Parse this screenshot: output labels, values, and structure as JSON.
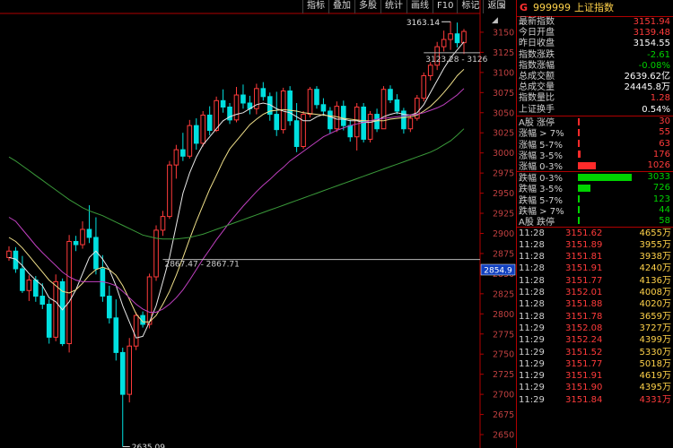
{
  "toolbar": {
    "buttons": [
      "指标",
      "叠加",
      "多股",
      "统计",
      "画线",
      "F10",
      "标记",
      "返回"
    ],
    "collapse_glyph": "◢",
    "close_glyph": "✕"
  },
  "chart_data": {
    "type": "candlestick",
    "title": "",
    "ylim": [
      2640,
      3170
    ],
    "y_ticks": [
      2650,
      2675,
      2700,
      2725,
      2750,
      2775,
      2800,
      2825,
      2850,
      2875,
      2900,
      2925,
      2950,
      2975,
      3000,
      3025,
      3050,
      3075,
      3100,
      3125,
      3150
    ],
    "annotations": {
      "high_label": "3163.14",
      "low_label": "2635.09",
      "range_label_low": "2867.47 - 2867.71",
      "range_label_high": "3123.28 - 3126",
      "price_marker": "2854.9"
    },
    "candles": [
      {
        "o": 2870,
        "h": 2884,
        "l": 2866,
        "c": 2878
      },
      {
        "o": 2878,
        "h": 2883,
        "l": 2851,
        "c": 2856
      },
      {
        "o": 2856,
        "h": 2872,
        "l": 2826,
        "c": 2829
      },
      {
        "o": 2829,
        "h": 2848,
        "l": 2816,
        "c": 2842
      },
      {
        "o": 2842,
        "h": 2847,
        "l": 2815,
        "c": 2822
      },
      {
        "o": 2822,
        "h": 2838,
        "l": 2806,
        "c": 2812
      },
      {
        "o": 2812,
        "h": 2818,
        "l": 2763,
        "c": 2771
      },
      {
        "o": 2771,
        "h": 2849,
        "l": 2766,
        "c": 2840
      },
      {
        "o": 2840,
        "h": 2844,
        "l": 2760,
        "c": 2763
      },
      {
        "o": 2763,
        "h": 2898,
        "l": 2752,
        "c": 2890
      },
      {
        "o": 2890,
        "h": 2897,
        "l": 2878,
        "c": 2886
      },
      {
        "o": 2886,
        "h": 2915,
        "l": 2881,
        "c": 2905
      },
      {
        "o": 2905,
        "h": 2935,
        "l": 2888,
        "c": 2895
      },
      {
        "o": 2895,
        "h": 2920,
        "l": 2849,
        "c": 2856
      },
      {
        "o": 2856,
        "h": 2873,
        "l": 2815,
        "c": 2822
      },
      {
        "o": 2822,
        "h": 2835,
        "l": 2788,
        "c": 2795
      },
      {
        "o": 2795,
        "h": 2818,
        "l": 2742,
        "c": 2752
      },
      {
        "o": 2752,
        "h": 2758,
        "l": 2635,
        "c": 2700
      },
      {
        "o": 2700,
        "h": 2770,
        "l": 2690,
        "c": 2760
      },
      {
        "o": 2760,
        "h": 2802,
        "l": 2755,
        "c": 2798
      },
      {
        "o": 2798,
        "h": 2803,
        "l": 2783,
        "c": 2787
      },
      {
        "o": 2787,
        "h": 2850,
        "l": 2782,
        "c": 2846
      },
      {
        "o": 2846,
        "h": 2910,
        "l": 2841,
        "c": 2904
      },
      {
        "o": 2904,
        "h": 2928,
        "l": 2897,
        "c": 2921
      },
      {
        "o": 2921,
        "h": 2990,
        "l": 2918,
        "c": 2985
      },
      {
        "o": 2985,
        "h": 3010,
        "l": 2968,
        "c": 3004
      },
      {
        "o": 3004,
        "h": 3025,
        "l": 2990,
        "c": 2996
      },
      {
        "o": 2996,
        "h": 3041,
        "l": 2993,
        "c": 3034
      },
      {
        "o": 3034,
        "h": 3043,
        "l": 3004,
        "c": 3012
      },
      {
        "o": 3012,
        "h": 3052,
        "l": 3008,
        "c": 3047
      },
      {
        "o": 3047,
        "h": 3058,
        "l": 3022,
        "c": 3028
      },
      {
        "o": 3028,
        "h": 3070,
        "l": 3026,
        "c": 3065
      },
      {
        "o": 3065,
        "h": 3079,
        "l": 3050,
        "c": 3057
      },
      {
        "o": 3057,
        "h": 3062,
        "l": 3036,
        "c": 3041
      },
      {
        "o": 3041,
        "h": 3082,
        "l": 3038,
        "c": 3072
      },
      {
        "o": 3072,
        "h": 3085,
        "l": 3055,
        "c": 3062
      },
      {
        "o": 3062,
        "h": 3071,
        "l": 3048,
        "c": 3055
      },
      {
        "o": 3055,
        "h": 3086,
        "l": 3048,
        "c": 3080
      },
      {
        "o": 3080,
        "h": 3088,
        "l": 3065,
        "c": 3070
      },
      {
        "o": 3070,
        "h": 3075,
        "l": 3040,
        "c": 3048
      },
      {
        "o": 3048,
        "h": 3076,
        "l": 3021,
        "c": 3029
      },
      {
        "o": 3029,
        "h": 3081,
        "l": 3024,
        "c": 3077
      },
      {
        "o": 3077,
        "h": 3083,
        "l": 3034,
        "c": 3040
      },
      {
        "o": 3040,
        "h": 3062,
        "l": 3001,
        "c": 3008
      },
      {
        "o": 3008,
        "h": 3052,
        "l": 3005,
        "c": 3048
      },
      {
        "o": 3048,
        "h": 3082,
        "l": 3044,
        "c": 3079
      },
      {
        "o": 3079,
        "h": 3083,
        "l": 3055,
        "c": 3060
      },
      {
        "o": 3060,
        "h": 3068,
        "l": 3046,
        "c": 3052
      },
      {
        "o": 3052,
        "h": 3057,
        "l": 3024,
        "c": 3030
      },
      {
        "o": 3030,
        "h": 3064,
        "l": 3026,
        "c": 3058
      },
      {
        "o": 3058,
        "h": 3065,
        "l": 3028,
        "c": 3034
      },
      {
        "o": 3034,
        "h": 3041,
        "l": 3014,
        "c": 3020
      },
      {
        "o": 3020,
        "h": 3062,
        "l": 3003,
        "c": 3057
      },
      {
        "o": 3057,
        "h": 3062,
        "l": 3013,
        "c": 3017
      },
      {
        "o": 3017,
        "h": 3052,
        "l": 3013,
        "c": 3048
      },
      {
        "o": 3048,
        "h": 3055,
        "l": 3026,
        "c": 3030
      },
      {
        "o": 3030,
        "h": 3083,
        "l": 3030,
        "c": 3079
      },
      {
        "o": 3079,
        "h": 3084,
        "l": 3062,
        "c": 3066
      },
      {
        "o": 3066,
        "h": 3073,
        "l": 3048,
        "c": 3052
      },
      {
        "o": 3052,
        "h": 3056,
        "l": 3024,
        "c": 3030
      },
      {
        "o": 3030,
        "h": 3048,
        "l": 3026,
        "c": 3043
      },
      {
        "o": 3043,
        "h": 3072,
        "l": 3040,
        "c": 3068
      },
      {
        "o": 3068,
        "h": 3100,
        "l": 3064,
        "c": 3096
      },
      {
        "o": 3096,
        "h": 3113,
        "l": 3090,
        "c": 3109
      },
      {
        "o": 3109,
        "h": 3138,
        "l": 3103,
        "c": 3132
      },
      {
        "o": 3132,
        "h": 3152,
        "l": 3126,
        "c": 3141
      },
      {
        "o": 3141,
        "h": 3163,
        "l": 3128,
        "c": 3148
      },
      {
        "o": 3148,
        "h": 3162,
        "l": 3131,
        "c": 3137
      },
      {
        "o": 3137,
        "h": 3154,
        "l": 3123,
        "c": 3151
      }
    ],
    "ma_series": [
      {
        "color": "#e8e8e8",
        "values": [
          2870,
          2868,
          2860,
          2850,
          2842,
          2835,
          2820,
          2815,
          2805,
          2815,
          2830,
          2850,
          2870,
          2878,
          2868,
          2855,
          2835,
          2810,
          2790,
          2770,
          2772,
          2790,
          2810,
          2840,
          2870,
          2910,
          2950,
          2975,
          2995,
          3010,
          3020,
          3030,
          3040,
          3045,
          3048,
          3050,
          3055,
          3060,
          3062,
          3060,
          3055,
          3052,
          3050,
          3045,
          3040,
          3040,
          3045,
          3048,
          3045,
          3042,
          3042,
          3040,
          3040,
          3038,
          3038,
          3040,
          3045,
          3048,
          3050,
          3048,
          3047,
          3050,
          3060,
          3075,
          3090,
          3105,
          3118,
          3128,
          3138
        ]
      },
      {
        "color": "#f0e08a",
        "values": [
          2895,
          2890,
          2882,
          2872,
          2862,
          2852,
          2842,
          2835,
          2828,
          2826,
          2830,
          2838,
          2848,
          2855,
          2858,
          2855,
          2848,
          2835,
          2818,
          2800,
          2790,
          2790,
          2798,
          2812,
          2828,
          2848,
          2870,
          2893,
          2915,
          2935,
          2955,
          2972,
          2990,
          3005,
          3015,
          3025,
          3035,
          3042,
          3048,
          3052,
          3053,
          3054,
          3053,
          3052,
          3050,
          3049,
          3048,
          3047,
          3046,
          3045,
          3043,
          3042,
          3041,
          3040,
          3040,
          3040,
          3040,
          3042,
          3043,
          3044,
          3045,
          3047,
          3052,
          3058,
          3066,
          3075,
          3085,
          3096,
          3104
        ]
      },
      {
        "color": "#c040c0",
        "values": [
          2920,
          2915,
          2905,
          2895,
          2885,
          2876,
          2868,
          2860,
          2852,
          2846,
          2842,
          2840,
          2840,
          2840,
          2840,
          2838,
          2835,
          2828,
          2820,
          2812,
          2806,
          2802,
          2802,
          2806,
          2812,
          2820,
          2830,
          2842,
          2855,
          2868,
          2880,
          2892,
          2903,
          2914,
          2924,
          2934,
          2943,
          2952,
          2960,
          2967,
          2975,
          2982,
          2990,
          2996,
          3002,
          3008,
          3014,
          3020,
          3024,
          3028,
          3031,
          3034,
          3036,
          3038,
          3040,
          3042,
          3043,
          3044,
          3045,
          3046,
          3047,
          3048,
          3050,
          3053,
          3056,
          3060,
          3066,
          3072,
          3080
        ]
      },
      {
        "color": "#3a9a3a",
        "values": [
          2995,
          2990,
          2984,
          2978,
          2972,
          2966,
          2960,
          2954,
          2948,
          2942,
          2937,
          2932,
          2928,
          2925,
          2922,
          2918,
          2914,
          2910,
          2906,
          2902,
          2898,
          2896,
          2894,
          2893,
          2893,
          2893,
          2894,
          2895,
          2897,
          2899,
          2902,
          2905,
          2908,
          2911,
          2914,
          2917,
          2920,
          2923,
          2926,
          2929,
          2932,
          2935,
          2938,
          2941,
          2944,
          2947,
          2950,
          2953,
          2956,
          2959,
          2962,
          2965,
          2968,
          2971,
          2974,
          2977,
          2980,
          2983,
          2986,
          2989,
          2992,
          2995,
          2998,
          3001,
          3005,
          3010,
          3015,
          3022,
          3030
        ]
      }
    ]
  },
  "quote": {
    "g_marker": "G",
    "code": "999999",
    "name": "上证指数",
    "rows": [
      {
        "label": "最新指数",
        "value": "3151.94",
        "cls": "red"
      },
      {
        "label": "今日开盘",
        "value": "3139.48",
        "cls": "red"
      },
      {
        "label": "昨日收盘",
        "value": "3154.55",
        "cls": "white"
      },
      {
        "label": "指数涨跌",
        "value": "-2.61",
        "cls": "green"
      },
      {
        "label": "指数涨幅",
        "value": "-0.08%",
        "cls": "green"
      },
      {
        "label": "总成交额",
        "value": "2639.62亿",
        "cls": "white"
      },
      {
        "label": "总成交量",
        "value": "24445.8万",
        "cls": "white"
      },
      {
        "label": "指数量比",
        "value": "1.28",
        "cls": "red"
      },
      {
        "label": "上证换手",
        "value": "0.54%",
        "cls": "white"
      }
    ],
    "distribution": [
      {
        "label": "A股 涨停",
        "value": "30",
        "cls": "red",
        "frac": 0.01,
        "color": "#ff2a2a"
      },
      {
        "label": "涨幅 > 7%",
        "value": "55",
        "cls": "red",
        "frac": 0.018,
        "color": "#ff2a2a"
      },
      {
        "label": "涨幅 5-7%",
        "value": "63",
        "cls": "red",
        "frac": 0.021,
        "color": "#ff2a2a"
      },
      {
        "label": "涨幅 3-5%",
        "value": "176",
        "cls": "red",
        "frac": 0.058,
        "color": "#ff2a2a"
      },
      {
        "label": "涨幅 0-3%",
        "value": "1026",
        "cls": "red",
        "frac": 0.34,
        "color": "#ff2a2a"
      },
      {
        "label": "跌幅 0-3%",
        "value": "3033",
        "cls": "green",
        "frac": 1.0,
        "color": "#00d200"
      },
      {
        "label": "跌幅 3-5%",
        "value": "726",
        "cls": "green",
        "frac": 0.24,
        "color": "#00d200"
      },
      {
        "label": "跌幅 5-7%",
        "value": "123",
        "cls": "green",
        "frac": 0.041,
        "color": "#00d200"
      },
      {
        "label": "跌幅 > 7%",
        "value": "44",
        "cls": "green",
        "frac": 0.015,
        "color": "#00d200"
      },
      {
        "label": "A股 跌停",
        "value": "58",
        "cls": "green",
        "frac": 0.019,
        "color": "#00d200"
      }
    ],
    "ticks": [
      {
        "time": "11:28",
        "price": "3151.62",
        "vol": "4655万",
        "vcls": ""
      },
      {
        "time": "11:28",
        "price": "3151.89",
        "vol": "3955万",
        "vcls": ""
      },
      {
        "time": "11:28",
        "price": "3151.81",
        "vol": "3938万",
        "vcls": ""
      },
      {
        "time": "11:28",
        "price": "3151.91",
        "vol": "4240万",
        "vcls": ""
      },
      {
        "time": "11:28",
        "price": "3151.77",
        "vol": "4136万",
        "vcls": ""
      },
      {
        "time": "11:28",
        "price": "3152.01",
        "vol": "4008万",
        "vcls": ""
      },
      {
        "time": "11:28",
        "price": "3151.88",
        "vol": "4020万",
        "vcls": ""
      },
      {
        "time": "11:28",
        "price": "3151.78",
        "vol": "3659万",
        "vcls": ""
      },
      {
        "time": "11:29",
        "price": "3152.08",
        "vol": "3727万",
        "vcls": ""
      },
      {
        "time": "11:29",
        "price": "3152.24",
        "vol": "4399万",
        "vcls": ""
      },
      {
        "time": "11:29",
        "price": "3151.52",
        "vol": "5330万",
        "vcls": ""
      },
      {
        "time": "11:29",
        "price": "3151.77",
        "vol": "5018万",
        "vcls": ""
      },
      {
        "time": "11:29",
        "price": "3151.91",
        "vol": "4619万",
        "vcls": ""
      },
      {
        "time": "11:29",
        "price": "3151.90",
        "vol": "4395万",
        "vcls": ""
      },
      {
        "time": "11:29",
        "price": "3151.84",
        "vol": "4331万",
        "vcls": "red"
      }
    ]
  }
}
